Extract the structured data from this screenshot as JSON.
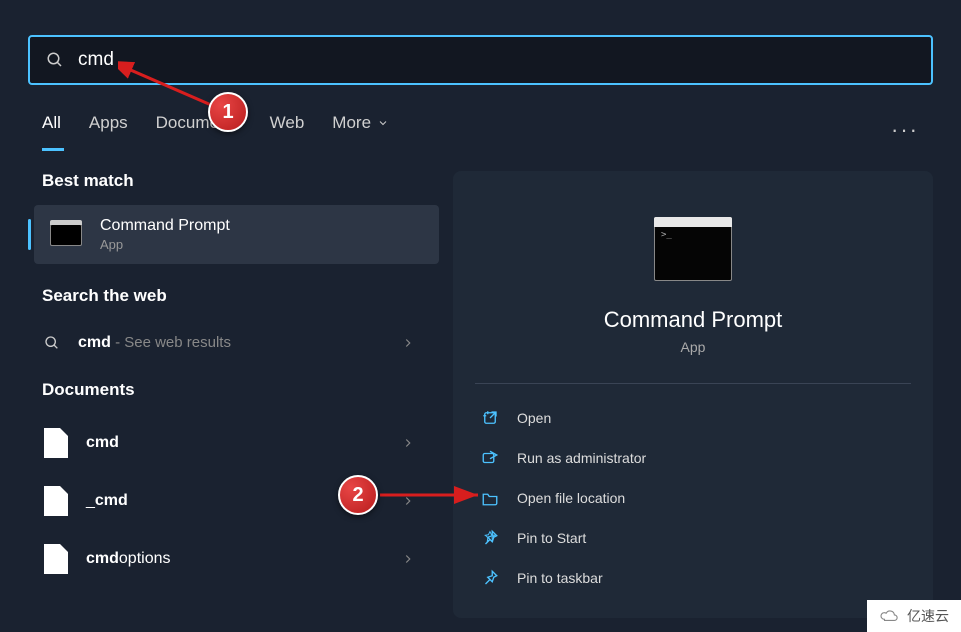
{
  "search": {
    "value": "cmd"
  },
  "tabs": [
    "All",
    "Apps",
    "Documents",
    "Web",
    "More"
  ],
  "sections": {
    "best_match": "Best match",
    "search_web": "Search the web",
    "documents": "Documents"
  },
  "best_match_item": {
    "title": "Command Prompt",
    "subtitle": "App"
  },
  "web_result": {
    "prefix": "cmd",
    "suffix": " - See web results"
  },
  "documents_list": [
    {
      "match": "cmd",
      "rest": ""
    },
    {
      "match": "",
      "rest_prefix": "_",
      "match2": "cmd",
      "rest2": ""
    },
    {
      "match": "cmd",
      "rest": "options"
    }
  ],
  "doc_items": {
    "d0": "cmd",
    "d1_prefix": "_",
    "d1_match": "cmd",
    "d2_match": "cmd",
    "d2_rest": "options"
  },
  "preview": {
    "title": "Command Prompt",
    "subtitle": "App"
  },
  "actions": {
    "open": "Open",
    "run_admin": "Run as administrator",
    "open_loc": "Open file location",
    "pin_start": "Pin to Start",
    "pin_taskbar": "Pin to taskbar"
  },
  "callouts": {
    "c1": "1",
    "c2": "2"
  },
  "watermark": "亿速云"
}
